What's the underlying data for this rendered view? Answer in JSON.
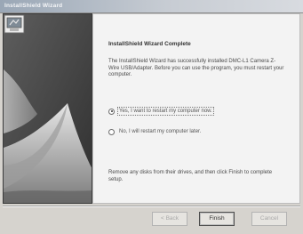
{
  "window": {
    "title": "InstallShield Wizard"
  },
  "content": {
    "heading": "InstallShield Wizard Complete",
    "body": "The InstallShield Wizard has successfully installed DMC-L1 Camera Z-Wire USB/Adapter. Before you can use the program, you must restart your computer.",
    "options": [
      {
        "label": "Yes, I want to restart my computer now.",
        "checked": true
      },
      {
        "label": "No, I will restart my computer later.",
        "checked": false
      }
    ],
    "instruction": "Remove any disks from their drives, and then click Finish to complete setup."
  },
  "buttons": {
    "back": "< Back",
    "finish": "Finish",
    "cancel": "Cancel"
  },
  "colors": {
    "window_bg": "#d6d3ce",
    "art_bg": "#4d4d4d",
    "content_bg": "#f3f3f3"
  }
}
